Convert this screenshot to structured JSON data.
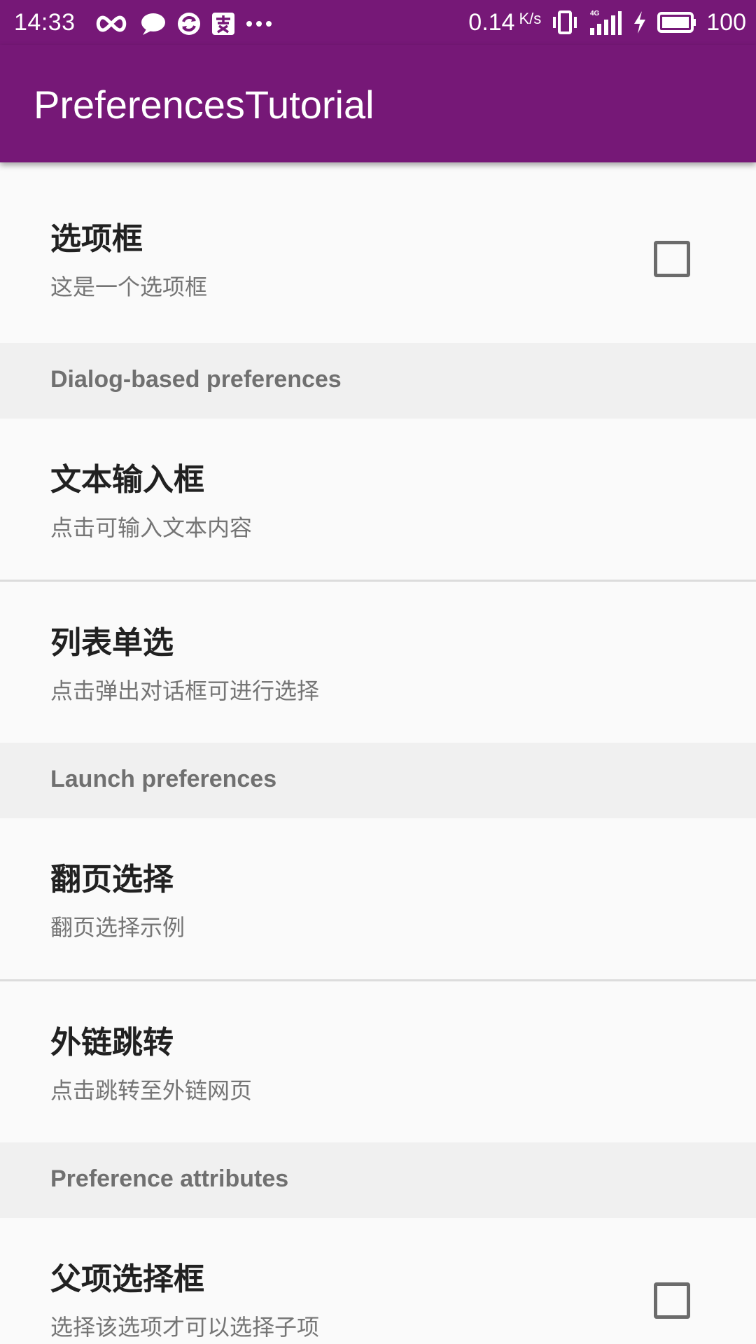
{
  "status_bar": {
    "time": "14:33",
    "net_speed": "0.14",
    "net_unit": "K/s",
    "network_type": "4G",
    "battery": "100"
  },
  "app_bar": {
    "title": "PreferencesTutorial"
  },
  "items": {
    "checkbox_pref": {
      "title": "选项框",
      "summary": "这是一个选项框",
      "checked": false
    },
    "category_dialog": "Dialog-based preferences",
    "edit_text_pref": {
      "title": "文本输入框",
      "summary": "点击可输入文本内容"
    },
    "list_pref": {
      "title": "列表单选",
      "summary": "点击弹出对话框可进行选择"
    },
    "category_launch": "Launch preferences",
    "screen_pref": {
      "title": "翻页选择",
      "summary": "翻页选择示例"
    },
    "intent_pref": {
      "title": "外链跳转",
      "summary": "点击跳转至外链网页"
    },
    "category_attributes": "Preference attributes",
    "parent_checkbox_pref": {
      "title": "父项选择框",
      "summary": "选择该选项才可以选择子项",
      "checked": false
    }
  },
  "colors": {
    "primary": "#761877",
    "background": "#fafafa",
    "category_background": "#f0f0f0"
  }
}
